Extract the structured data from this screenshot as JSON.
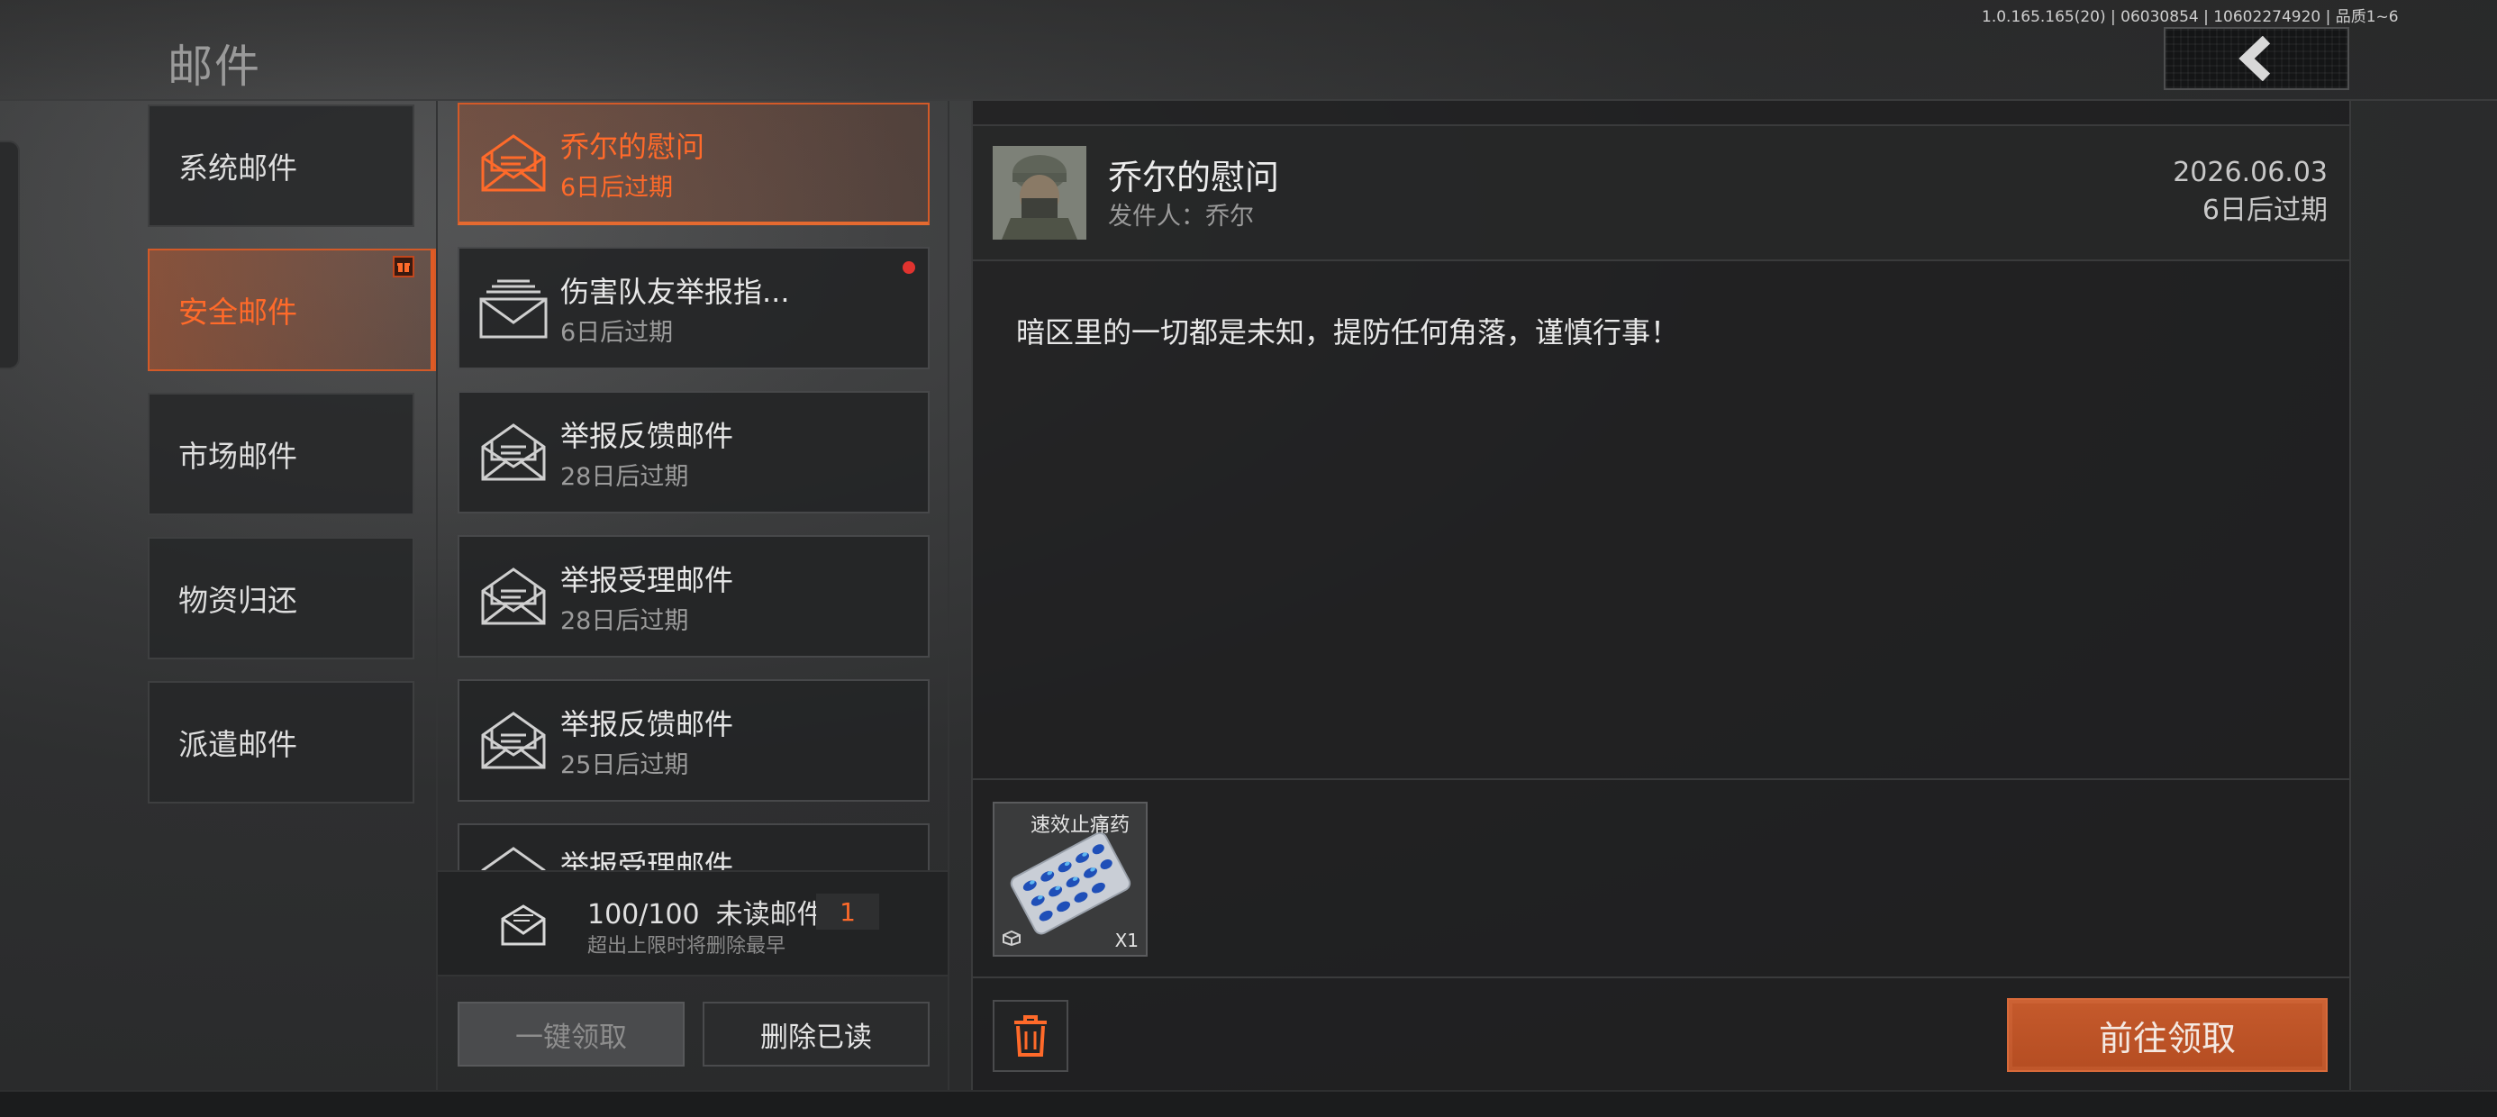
{
  "header": {
    "title": "邮件",
    "version_info": "1.0.165.165(20) | 06030854 | 10602274920 | 品质1~6"
  },
  "categories": [
    {
      "label": "系统邮件",
      "active": false
    },
    {
      "label": "安全邮件",
      "active": true
    },
    {
      "label": "市场邮件",
      "active": false
    },
    {
      "label": "物资归还",
      "active": false
    },
    {
      "label": "派遣邮件",
      "active": false
    }
  ],
  "mails": [
    {
      "title": "乔尔的慰问",
      "expire": "6日后过期",
      "selected": true,
      "unread": false
    },
    {
      "title": "伤害队友举报指...",
      "expire": "6日后过期",
      "selected": false,
      "unread": true
    },
    {
      "title": "举报反馈邮件",
      "expire": "28日后过期",
      "selected": false,
      "unread": false
    },
    {
      "title": "举报受理邮件",
      "expire": "28日后过期",
      "selected": false,
      "unread": false
    },
    {
      "title": "举报反馈邮件",
      "expire": "25日后过期",
      "selected": false,
      "unread": false
    },
    {
      "title": "举报受理邮件",
      "expire": "",
      "selected": false,
      "unread": false
    }
  ],
  "counter": {
    "capacity": "100/100",
    "unread_label": "未读邮件",
    "unread_count": "1",
    "note": "超出上限时将删除最早"
  },
  "list_actions": {
    "claim_all": "一键领取",
    "delete_read": "删除已读"
  },
  "detail": {
    "title": "乔尔的慰问",
    "sender": "发件人：乔尔",
    "date": "2026.06.03",
    "expire": "6日后过期",
    "body": "暗区里的一切都是未知，提防任何角落，谨慎行事！",
    "attachment": {
      "name": "速效止痛药",
      "qty": "X1"
    },
    "goto_button": "前往领取"
  },
  "colors": {
    "accent": "#e05a24",
    "accent_text": "#ff6a2a",
    "unread_dot": "#e0332f",
    "button_primary": "#c55a2c"
  },
  "icons": [
    "back-arrow-icon",
    "envelope-icon",
    "envelope-stack-icon",
    "trash-icon",
    "pill-pack-icon",
    "gift-icon"
  ]
}
